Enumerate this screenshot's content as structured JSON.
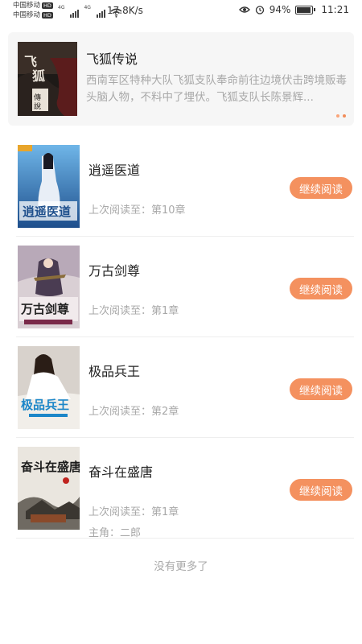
{
  "status_bar": {
    "carrier_1": "中国移动",
    "carrier_2": "中国移动",
    "hd_label": "HD",
    "network_1": "4G",
    "network_2": "4G",
    "speed": "17.8K/s",
    "battery": "94%",
    "time": "11:21",
    "icons": [
      "eye-icon",
      "alarm-icon",
      "battery-icon",
      "wifi-icon",
      "signal-icon"
    ]
  },
  "banner": {
    "title": "飞狐传说",
    "description": "西南军区特种大队飞狐支队奉命前往边境伏击跨境贩毒头脑人物，不料中了埋伏。飞狐支队长陈景辉...",
    "page_dots": 2,
    "active_dot": 1
  },
  "books": [
    {
      "title": "逍遥医道",
      "progress": "上次阅读至：第10章",
      "button": "继续阅读",
      "cover_text": "逍遥医道"
    },
    {
      "title": "万古剑尊",
      "progress": "上次阅读至：第1章",
      "button": "继续阅读",
      "cover_text": "万古剑尊"
    },
    {
      "title": "极品兵王",
      "progress": "上次阅读至：第2章",
      "button": "继续阅读",
      "cover_text": "极品兵王"
    },
    {
      "title": "奋斗在盛唐",
      "progress": "上次阅读至：第1章",
      "extra": "主角：二郎",
      "button": "继续阅读",
      "cover_text": "奋斗在盛唐"
    }
  ],
  "footer": {
    "no_more": "没有更多了"
  },
  "colors": {
    "accent": "#f4915f",
    "muted_text": "#a8a8a8",
    "banner_bg": "#f6f6f6"
  }
}
